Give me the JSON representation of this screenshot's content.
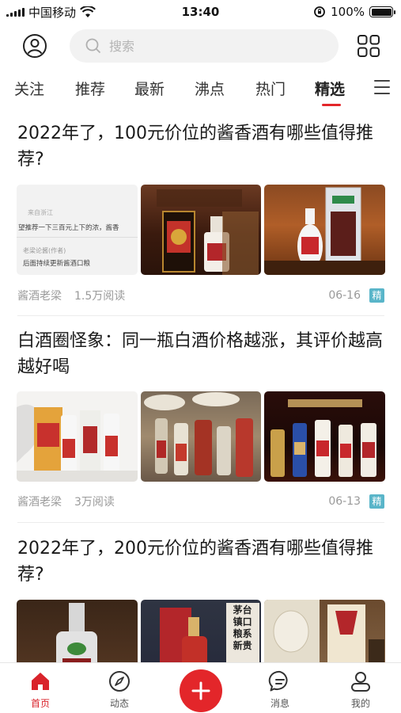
{
  "status_bar": {
    "carrier": "中国移动",
    "time": "13:40",
    "battery": "100%",
    "battery_level": 1.0
  },
  "header": {
    "search_placeholder": "搜索"
  },
  "tabs": [
    {
      "label": "关注"
    },
    {
      "label": "推荐"
    },
    {
      "label": "最新"
    },
    {
      "label": "沸点"
    },
    {
      "label": "热门"
    },
    {
      "label": "精选",
      "active": true
    }
  ],
  "articles": [
    {
      "title": "2022年了，100元价位的酱香酒有哪些值得推荐?",
      "author": "酱酒老梁",
      "views": "1.5万阅读",
      "date": "06-16",
      "badge": "精",
      "thumb_texts": {
        "from": "来自浙江",
        "question": "望推荐一下三百元上下的浓，酱香",
        "author_tag": "老梁论酱(作者)",
        "reply": "后面持续更新酱酒口粮"
      }
    },
    {
      "title": "白酒圈怪象：同一瓶白酒价格越涨，其评价越高越好喝",
      "author": "酱酒老梁",
      "views": "3万阅读",
      "date": "06-13",
      "badge": "精"
    },
    {
      "title": "2022年了，200元价位的酱香酒有哪些值得推荐?",
      "thumb_texts": {
        "vertical_label": "茅台镇口粮系新贵"
      }
    }
  ],
  "bottom_nav": [
    {
      "label": "首页",
      "icon": "home-icon",
      "active": true
    },
    {
      "label": "动态",
      "icon": "compass-icon"
    },
    {
      "label": "",
      "icon": "plus-icon"
    },
    {
      "label": "消息",
      "icon": "message-icon"
    },
    {
      "label": "我的",
      "icon": "profile-icon"
    }
  ],
  "colors": {
    "accent": "#e3262a",
    "badge": "#59b5c9"
  }
}
